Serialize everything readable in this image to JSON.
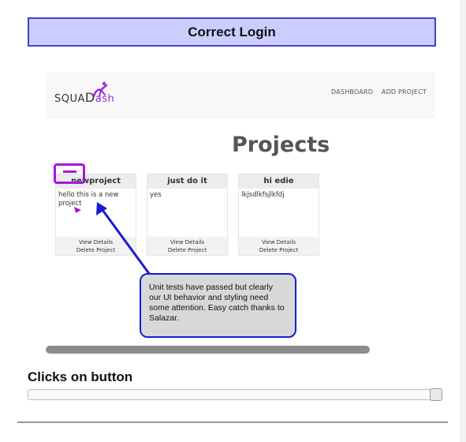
{
  "banner": {
    "title": "Correct Login"
  },
  "app": {
    "logo": {
      "prefix": "SQUA",
      "d": "D",
      "suffix": "ash"
    },
    "nav": [
      "DASHBOARD",
      "ADD PROJECT"
    ],
    "page_title": "Projects",
    "projects": [
      {
        "name": "newproject",
        "description": "hello this is a new project",
        "view_label": "View Details",
        "delete_label": "Delete Project"
      },
      {
        "name": "just do it",
        "description": "yes",
        "view_label": "View Details",
        "delete_label": "Delete Project"
      },
      {
        "name": "hi edie",
        "description": "lkjsdlkfsjlkfdj",
        "view_label": "View Details",
        "delete_label": "Delete Project"
      }
    ]
  },
  "annotation": {
    "callout_text": "Unit tests have passed but clearly our UI behavior and styling need some attention. Easy catch thanks to Salazar.",
    "accent_color": "#a418e0",
    "arrow_color": "#1a1ad0"
  },
  "slider_section": {
    "label": "Clicks on button",
    "value_fraction": 1.0
  }
}
